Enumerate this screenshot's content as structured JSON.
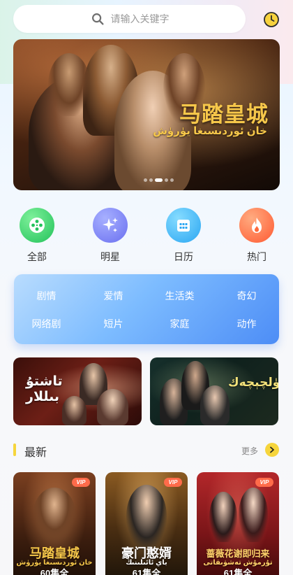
{
  "search": {
    "placeholder": "请输入关键字"
  },
  "banner": {
    "title_cn": "马踏皇城",
    "title_ug": "خان ئوردىسىغا يۈرۈش",
    "slides": 5,
    "active_slide": 3
  },
  "quick_nav": [
    {
      "label": "全部",
      "icon": "film-reel-icon",
      "color": "#3bd46a"
    },
    {
      "label": "明星",
      "icon": "sparkle-icon",
      "color": "#7c86f8"
    },
    {
      "label": "日历",
      "icon": "calendar-icon",
      "color": "#36b3f7"
    },
    {
      "label": "热门",
      "icon": "flame-icon",
      "color": "#ff6f45"
    }
  ],
  "genres": [
    "剧情",
    "爱情",
    "生活类",
    "奇幻",
    "网络剧",
    "短片",
    "家庭",
    "动作"
  ],
  "promos": [
    {
      "title_ug": "تاشتۇ بىللار"
    },
    {
      "title_ug": "ئايگۈلچېچەك"
    }
  ],
  "section": {
    "title": "最新",
    "more": "更多"
  },
  "cards": [
    {
      "title_cn": "马踏皇城",
      "title_ug": "خان ئوردىسىغا يۈرۈش",
      "episodes": "60集全",
      "vip": "VIP",
      "title_color": "#f6c74a"
    },
    {
      "title_cn": "豪门憨婿",
      "title_ug": "باي ئائىلىنىڭ",
      "episodes": "61集全",
      "vip": "VIP",
      "title_color": "#ffffff"
    },
    {
      "title_cn": "蔷薇花谢即归来",
      "title_ug": "تۇرمۇش تەشۋىقاتى",
      "episodes": "61集全",
      "vip": "VIP",
      "title_color": "#ffd36b"
    }
  ],
  "colors": {
    "accent_yellow": "#f6d53c",
    "genre_blue": "#4d8df6"
  }
}
